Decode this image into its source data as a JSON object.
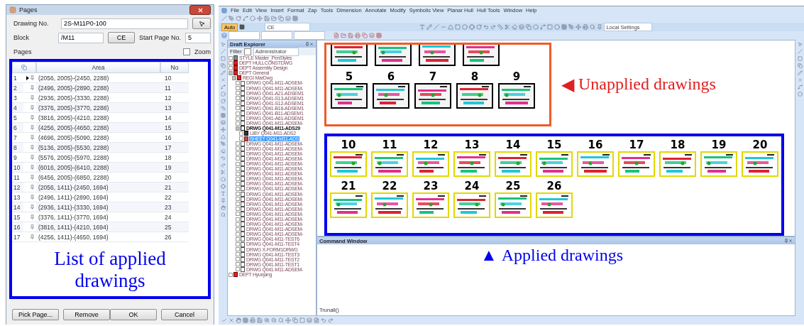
{
  "dialog": {
    "title": "Pages",
    "drawing_no": {
      "label": "Drawing No.",
      "value": "2S-M11P0-100"
    },
    "block": {
      "label": "Block",
      "value": "/M11",
      "button": "CE"
    },
    "start_page": {
      "label": "Start Page No.",
      "value": "5"
    },
    "pages_label": "Pages",
    "zoom": {
      "label": "Zoom",
      "checked": false
    },
    "table": {
      "columns": [
        "Area",
        "No"
      ],
      "rows": [
        {
          "index": "1",
          "area": "(2056, 2005)-(2450, 2288)",
          "no": "10",
          "current": true
        },
        {
          "index": "2",
          "area": "(2496, 2005)-(2890, 2288)",
          "no": "11",
          "current": false
        },
        {
          "index": "3",
          "area": "(2936, 2005)-(3330, 2288)",
          "no": "12",
          "current": false
        },
        {
          "index": "4",
          "area": "(3376, 2005)-(3770, 2288)",
          "no": "13",
          "current": false
        },
        {
          "index": "5",
          "area": "(3816, 2005)-(4210, 2288)",
          "no": "14",
          "current": false
        },
        {
          "index": "6",
          "area": "(4256, 2005)-(4650, 2288)",
          "no": "15",
          "current": false
        },
        {
          "index": "7",
          "area": "(4696, 2005)-(5090, 2288)",
          "no": "16",
          "current": false
        },
        {
          "index": "8",
          "area": "(5136, 2005)-(5530, 2288)",
          "no": "17",
          "current": false
        },
        {
          "index": "9",
          "area": "(5576, 2005)-(5970, 2288)",
          "no": "18",
          "current": false
        },
        {
          "index": "10",
          "area": "(6016, 2005)-(6410, 2288)",
          "no": "19",
          "current": false
        },
        {
          "index": "11",
          "area": "(6456, 2005)-(6850, 2288)",
          "no": "20",
          "current": false
        },
        {
          "index": "12",
          "area": "(2056, 1411)-(2450, 1694)",
          "no": "21",
          "current": false
        },
        {
          "index": "13",
          "area": "(2496, 1411)-(2890, 1694)",
          "no": "22",
          "current": false
        },
        {
          "index": "14",
          "area": "(2936, 1411)-(3330, 1694)",
          "no": "23",
          "current": false
        },
        {
          "index": "15",
          "area": "(3376, 1411)-(3770, 1694)",
          "no": "24",
          "current": false
        },
        {
          "index": "16",
          "area": "(3816, 1411)-(4210, 1694)",
          "no": "25",
          "current": false
        },
        {
          "index": "17",
          "area": "(4256, 1411)-(4650, 1694)",
          "no": "26",
          "current": false
        }
      ]
    },
    "buttons": [
      "Pick Page...",
      "Remove",
      "OK",
      "Cancel"
    ]
  },
  "list_annotation": "List of applied drawings",
  "app": {
    "menu": [
      "File",
      "Edit",
      "View",
      "Insert",
      "Format",
      "Zap",
      "Tools",
      "Dimension",
      "Annotate",
      "Modify",
      "Symbolic View",
      "Planar Hull",
      "Hull Tools",
      "Window",
      "Help"
    ],
    "toolbar": {
      "mode_button": "Auto",
      "ce_field": "CE",
      "settings": "Local Settings"
    },
    "explorer": {
      "title": "Draft Explorer",
      "filter_label": "Filter",
      "filter_checked": false,
      "filter_value": "Administrator",
      "tree": [
        {
          "label": "STYLE Master_PenStyles",
          "kind": "style",
          "expanded": false,
          "selected": false
        },
        {
          "label": "DEPT HULLCONSTDWG",
          "kind": "dept",
          "expanded": false,
          "selected": false
        },
        {
          "label": "DEPT Assembly Design",
          "kind": "dept",
          "expanded": false,
          "selected": false
        },
        {
          "label": "DEPT General",
          "kind": "dept",
          "expanded": true,
          "selected": false,
          "children": [
            {
              "label": "REGI MarDwg",
              "kind": "regi",
              "expanded": true,
              "selected": false,
              "children": [
                {
                  "label": "DRWG Q041-M11-ADSEM-",
                  "kind": "drwg",
                  "expanded": false,
                  "selected": false
                },
                {
                  "label": "DRWG Q041-M11-ADSEM-",
                  "kind": "drwg",
                  "expanded": false,
                  "selected": false
                },
                {
                  "label": "DRWG Q041-A21-ADSEM1",
                  "kind": "drwg",
                  "expanded": false,
                  "selected": false
                },
                {
                  "label": "DRWG Q041-S13-ADSEM1",
                  "kind": "drwg",
                  "expanded": false,
                  "selected": false
                },
                {
                  "label": "DRWG Q041-S12-ADSEM1",
                  "kind": "drwg",
                  "expanded": false,
                  "selected": false
                },
                {
                  "label": "DRWG Q041-B16-ADSEM1",
                  "kind": "drwg",
                  "expanded": false,
                  "selected": false
                },
                {
                  "label": "DRWG Q041-B11-ADSEM1",
                  "kind": "drwg",
                  "expanded": false,
                  "selected": false
                },
                {
                  "label": "DRWG Q041-A61-ADSEM1",
                  "kind": "drwg",
                  "expanded": false,
                  "selected": false
                },
                {
                  "label": "DRWG Q041-M11-ADSEM-",
                  "kind": "drwg",
                  "expanded": false,
                  "selected": false
                },
                {
                  "label": "DRWG Q041-M11-ADS29",
                  "kind": "drwg_open",
                  "expanded": true,
                  "selected": false,
                  "children": [
                    {
                      "label": "LIBY Q041-M11-ADS2",
                      "kind": "liby",
                      "expanded": false,
                      "selected": false
                    },
                    {
                      "label": "SHEET Q041-M11-ADS",
                      "kind": "sheet",
                      "expanded": false,
                      "selected": true
                    }
                  ]
                },
                {
                  "label": "DRWG Q041-M11-ADSEM-",
                  "kind": "drwg",
                  "expanded": false,
                  "selected": false
                },
                {
                  "label": "DRWG Q041-M11-ADSEM-",
                  "kind": "drwg",
                  "expanded": false,
                  "selected": false
                },
                {
                  "label": "DRWG Q041-M11-ADSEM-",
                  "kind": "drwg",
                  "expanded": false,
                  "selected": false
                },
                {
                  "label": "DRWG Q041-M11-ADSEM-",
                  "kind": "drwg",
                  "expanded": false,
                  "selected": false
                },
                {
                  "label": "DRWG Q041-M11-ADSEM-",
                  "kind": "drwg",
                  "expanded": false,
                  "selected": false
                },
                {
                  "label": "DRWG Q041-M11-ADSEM-",
                  "kind": "drwg",
                  "expanded": false,
                  "selected": false
                },
                {
                  "label": "DRWG Q041-M11-ADSEM-",
                  "kind": "drwg",
                  "expanded": false,
                  "selected": false
                },
                {
                  "label": "DRWG Q041-M11-ADSEM-",
                  "kind": "drwg",
                  "expanded": false,
                  "selected": false
                },
                {
                  "label": "DRWG Q041-M11-ADSEM-",
                  "kind": "drwg",
                  "expanded": false,
                  "selected": false
                },
                {
                  "label": "DRWG Q041-M11-ADSEM-",
                  "kind": "drwg",
                  "expanded": false,
                  "selected": false
                },
                {
                  "label": "DRWG Q041-M11-ADSEM-",
                  "kind": "drwg",
                  "expanded": false,
                  "selected": false
                },
                {
                  "label": "DRWG Q041-M11-ADSEM-",
                  "kind": "drwg",
                  "expanded": false,
                  "selected": false
                },
                {
                  "label": "DRWG Q041-M11-ADSEM-",
                  "kind": "drwg",
                  "expanded": false,
                  "selected": false
                },
                {
                  "label": "DRWG Q041-M11-ADSEM-",
                  "kind": "drwg",
                  "expanded": false,
                  "selected": false
                },
                {
                  "label": "DRWG Q041-M11-ADSEM-",
                  "kind": "drwg",
                  "expanded": false,
                  "selected": false
                },
                {
                  "label": "DRWG Q041-M11-ADSEM-",
                  "kind": "drwg",
                  "expanded": false,
                  "selected": false
                },
                {
                  "label": "DRWG Q041-M11-ADSEM-",
                  "kind": "drwg",
                  "expanded": false,
                  "selected": false
                },
                {
                  "label": "DRWG Q041-M11-ADSEM-",
                  "kind": "drwg",
                  "expanded": false,
                  "selected": false
                },
                {
                  "label": "DRWG Q041-M11-ADSEM-",
                  "kind": "drwg",
                  "expanded": false,
                  "selected": false
                },
                {
                  "label": "DRWG Q041-M11-TEST6",
                  "kind": "drwg",
                  "expanded": false,
                  "selected": false
                },
                {
                  "label": "DRWG Q041-M11-TEST4",
                  "kind": "drwg",
                  "expanded": false,
                  "selected": false
                },
                {
                  "label": "DRWG X-FORM1DRWG",
                  "kind": "drwg",
                  "expanded": false,
                  "selected": false
                },
                {
                  "label": "DRWG Q041-M11-TEST3",
                  "kind": "drwg",
                  "expanded": false,
                  "selected": false
                },
                {
                  "label": "DRWG Q041-M11-TEST2",
                  "kind": "drwg",
                  "expanded": false,
                  "selected": false
                },
                {
                  "label": "DRWG Q041-M11-TEST1",
                  "kind": "drwg",
                  "expanded": false,
                  "selected": false
                },
                {
                  "label": "DRWG Q041-M11-ADSEM-",
                  "kind": "drwg",
                  "expanded": false,
                  "selected": false
                }
              ]
            }
          ]
        },
        {
          "label": "DEPT Hyunjang",
          "kind": "dept",
          "expanded": false,
          "selected": false
        }
      ]
    },
    "unapplied": {
      "sheets": [
        {
          "label": "5"
        },
        {
          "label": "6"
        },
        {
          "label": "7"
        },
        {
          "label": "8"
        },
        {
          "label": "9"
        }
      ]
    },
    "unapplied_annotation": {
      "arrow": "◀",
      "text": "Unapplied drawings"
    },
    "applied": {
      "sheets": [
        {
          "label": "10"
        },
        {
          "label": "11"
        },
        {
          "label": "12"
        },
        {
          "label": "13"
        },
        {
          "label": "14"
        },
        {
          "label": "15"
        },
        {
          "label": "16"
        },
        {
          "label": "17"
        },
        {
          "label": "18"
        },
        {
          "label": "19"
        },
        {
          "label": "20"
        },
        {
          "label": "21"
        },
        {
          "label": "22"
        },
        {
          "label": "23"
        },
        {
          "label": "24"
        },
        {
          "label": "25"
        },
        {
          "label": "26"
        }
      ]
    },
    "applied_annotation": {
      "arrow": "▲",
      "text": "Applied drawings"
    },
    "command_window": {
      "title": "Command Window",
      "output": "Trunall()"
    }
  }
}
